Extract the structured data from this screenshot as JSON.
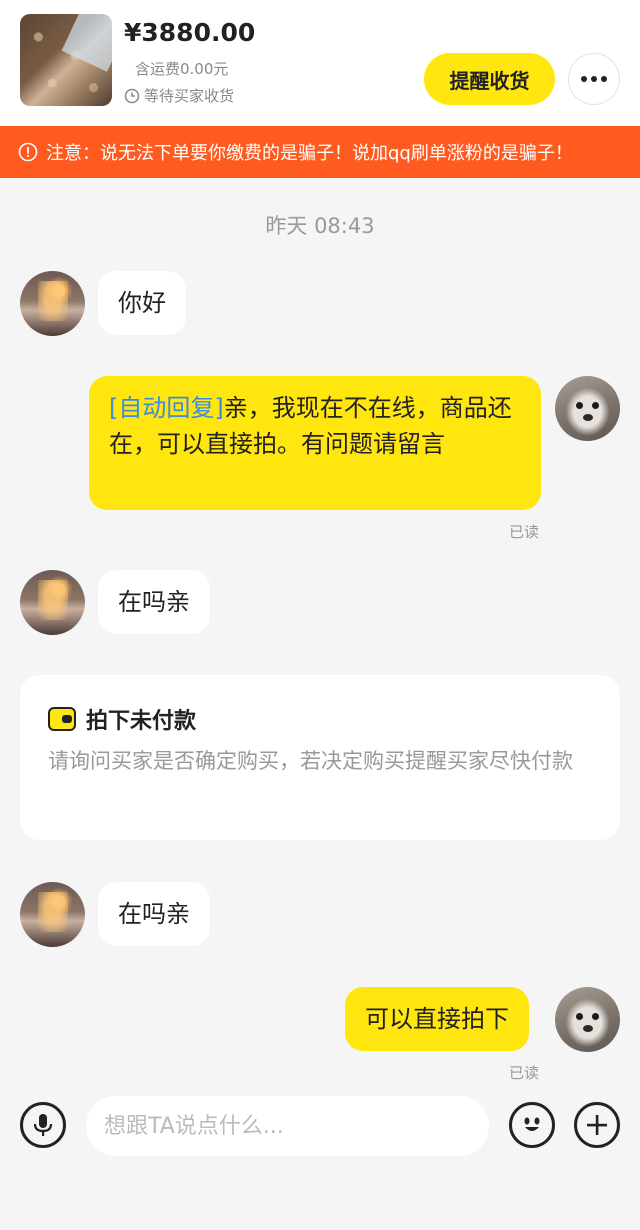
{
  "header": {
    "price": "¥3880.00",
    "shipping": "含运费0.00元",
    "status": "等待买家收货",
    "remind_button": "提醒收货",
    "more_icon": "more-icon"
  },
  "warning": {
    "text": "注意：说无法下单要你缴费的是骗子！说加qq刷单涨粉的是骗子！",
    "color": "#ff5a1f",
    "icon": "alert-icon"
  },
  "chat": {
    "timestamp": "昨天 08:43",
    "messages": [
      {
        "sender": "buyer",
        "text": "你好"
      },
      {
        "sender": "seller",
        "tag": "[自动回复]",
        "text": "亲，我现在不在线，商品还在，可以直接拍。有问题请留言",
        "read": "已读"
      },
      {
        "sender": "buyer",
        "text": "在吗亲"
      },
      {
        "sender": "buyer",
        "text": "在吗亲"
      },
      {
        "sender": "seller",
        "text": "可以直接拍下",
        "read": "已读"
      }
    ],
    "system_card": {
      "title": "拍下未付款",
      "body": "请询问买家是否确定购买，若决定购买提醒买家尽快付款",
      "icon": "wallet-icon"
    }
  },
  "input": {
    "placeholder": "想跟TA说点什么...",
    "voice_icon": "microphone-icon",
    "emoji_icon": "emoji-icon",
    "add_icon": "plus-icon"
  },
  "colors": {
    "accent": "#ffe60f",
    "background": "#f5f5f5",
    "link": "#3a8ce0"
  }
}
